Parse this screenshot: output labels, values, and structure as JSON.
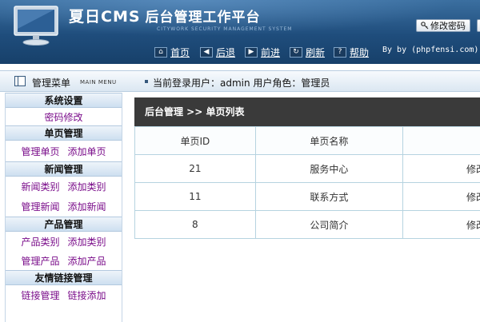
{
  "header": {
    "brand": "夏日CMS",
    "title": "后台管理工作平台",
    "tagline": "CITYWORK SECURITY MANAGEMENT SYSTEM",
    "change_password_label": "修改密码"
  },
  "nav": {
    "items": [
      {
        "icon": "home-icon",
        "label": "首页"
      },
      {
        "icon": "back-arrow-icon",
        "label": "后退"
      },
      {
        "icon": "forward-arrow-icon",
        "label": "前进"
      },
      {
        "icon": "refresh-icon",
        "label": "刷新"
      },
      {
        "icon": "help-icon",
        "label": "帮助"
      }
    ],
    "by_text": "By by (phpfensi.com)"
  },
  "subbar": {
    "menu_title": "管理菜单",
    "menu_title_en": "MAIN MENU",
    "user_info": "当前登录用户：admin  用户角色：管理员"
  },
  "sidebar": {
    "sections": [
      {
        "title": "系统设置",
        "rows": [
          [
            "密码修改"
          ]
        ]
      },
      {
        "title": "单页管理",
        "rows": [
          [
            "管理单页",
            "添加单页"
          ]
        ]
      },
      {
        "title": "新闻管理",
        "rows": [
          [
            "新闻类别",
            "添加类别"
          ],
          [
            "管理新闻",
            "添加新闻"
          ]
        ]
      },
      {
        "title": "产品管理",
        "rows": [
          [
            "产品类别",
            "添加类别"
          ],
          [
            "管理产品",
            "添加产品"
          ]
        ]
      },
      {
        "title": "友情链接管理",
        "rows": [
          [
            "链接管理",
            "链接添加"
          ]
        ]
      }
    ]
  },
  "main": {
    "breadcrumb": "后台管理 >> 单页列表",
    "table": {
      "columns": [
        "单页ID",
        "单页名称",
        ""
      ],
      "rows": [
        {
          "id": "21",
          "name": "服务中心",
          "op": "修改"
        },
        {
          "id": "11",
          "name": "联系方式",
          "op": "修改"
        },
        {
          "id": "8",
          "name": "公司简介",
          "op": "修改"
        }
      ]
    }
  }
}
